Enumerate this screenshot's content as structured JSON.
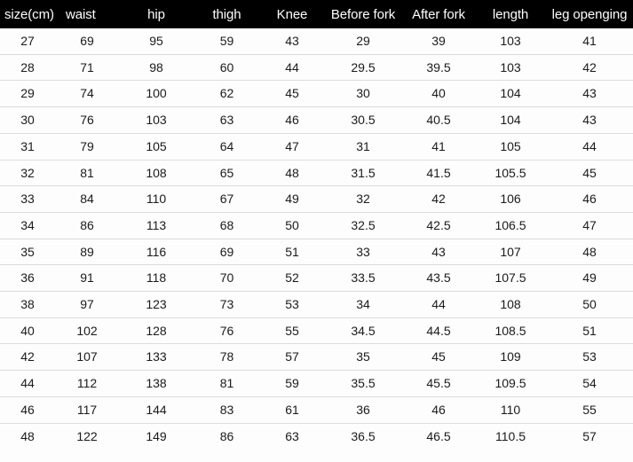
{
  "table": {
    "columns": [
      "size(cm)",
      "waist",
      "hip",
      "thigh",
      "Knee",
      "Before fork",
      "After fork",
      "length",
      "leg openging"
    ],
    "rows": [
      [
        "27",
        "69",
        "95",
        "59",
        "43",
        "29",
        "39",
        "103",
        "41"
      ],
      [
        "28",
        "71",
        "98",
        "60",
        "44",
        "29.5",
        "39.5",
        "103",
        "42"
      ],
      [
        "29",
        "74",
        "100",
        "62",
        "45",
        "30",
        "40",
        "104",
        "43"
      ],
      [
        "30",
        "76",
        "103",
        "63",
        "46",
        "30.5",
        "40.5",
        "104",
        "43"
      ],
      [
        "31",
        "79",
        "105",
        "64",
        "47",
        "31",
        "41",
        "105",
        "44"
      ],
      [
        "32",
        "81",
        "108",
        "65",
        "48",
        "31.5",
        "41.5",
        "105.5",
        "45"
      ],
      [
        "33",
        "84",
        "110",
        "67",
        "49",
        "32",
        "42",
        "106",
        "46"
      ],
      [
        "34",
        "86",
        "113",
        "68",
        "50",
        "32.5",
        "42.5",
        "106.5",
        "47"
      ],
      [
        "35",
        "89",
        "116",
        "69",
        "51",
        "33",
        "43",
        "107",
        "48"
      ],
      [
        "36",
        "91",
        "118",
        "70",
        "52",
        "33.5",
        "43.5",
        "107.5",
        "49"
      ],
      [
        "38",
        "97",
        "123",
        "73",
        "53",
        "34",
        "44",
        "108",
        "50"
      ],
      [
        "40",
        "102",
        "128",
        "76",
        "55",
        "34.5",
        "44.5",
        "108.5",
        "51"
      ],
      [
        "42",
        "107",
        "133",
        "78",
        "57",
        "35",
        "45",
        "109",
        "53"
      ],
      [
        "44",
        "112",
        "138",
        "81",
        "59",
        "35.5",
        "45.5",
        "109.5",
        "54"
      ],
      [
        "46",
        "117",
        "144",
        "83",
        "61",
        "36",
        "46",
        "110",
        "55"
      ],
      [
        "48",
        "122",
        "149",
        "86",
        "63",
        "36.5",
        "46.5",
        "110.5",
        "57"
      ]
    ]
  },
  "colors": {
    "header_background": "#000000",
    "header_text": "#ffffff",
    "body_background": "#fdfdfd",
    "body_text": "#1a1a1a",
    "row_separator": "#dcdcdc"
  }
}
